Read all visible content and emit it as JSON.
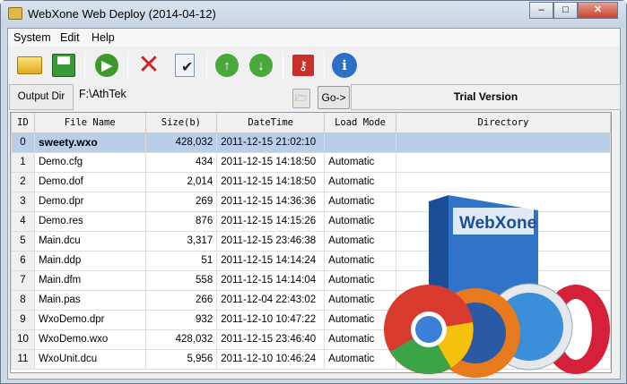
{
  "window": {
    "title": "WebXone Web Deploy (2014-04-12)"
  },
  "menu": [
    "System",
    "Edit",
    "Help"
  ],
  "toolbar": [
    "open-folder",
    "save",
    "run",
    "delete",
    "check-document",
    "move-up",
    "move-down",
    "key",
    "info"
  ],
  "output": {
    "label": "Output Dir",
    "value": "F:\\AthTek",
    "go": "Go->",
    "trial": "Trial Version"
  },
  "table": {
    "headers": [
      "ID",
      "File Name",
      "Size(b)",
      "DateTime",
      "Load Mode",
      "Directory"
    ],
    "rows": [
      [
        "0",
        "sweety.wxo",
        "428,032",
        "2011-12-15 21:02:10",
        "",
        ""
      ],
      [
        "1",
        "Demo.cfg",
        "434",
        "2011-12-15 14:18:50",
        "Automatic",
        ""
      ],
      [
        "2",
        "Demo.dof",
        "2,014",
        "2011-12-15 14:18:50",
        "Automatic",
        ""
      ],
      [
        "3",
        "Demo.dpr",
        "269",
        "2011-12-15 14:36:36",
        "Automatic",
        ""
      ],
      [
        "4",
        "Demo.res",
        "876",
        "2011-12-15 14:15:26",
        "Automatic",
        ""
      ],
      [
        "5",
        "Main.dcu",
        "3,317",
        "2011-12-15 23:46:38",
        "Automatic",
        ""
      ],
      [
        "6",
        "Main.ddp",
        "51",
        "2011-12-15 14:14:24",
        "Automatic",
        ""
      ],
      [
        "7",
        "Main.dfm",
        "558",
        "2011-12-15 14:14:04",
        "Automatic",
        ""
      ],
      [
        "8",
        "Main.pas",
        "266",
        "2011-12-04 22:43:02",
        "Automatic",
        ""
      ],
      [
        "9",
        "WxoDemo.dpr",
        "932",
        "2011-12-10 10:47:22",
        "Automatic",
        ""
      ],
      [
        "10",
        "WxoDemo.wxo",
        "428,032",
        "2011-12-15 23:46:40",
        "Automatic",
        ""
      ],
      [
        "11",
        "WxoUnit.dcu",
        "5,956",
        "2011-12-10 10:46:24",
        "Automatic",
        ""
      ]
    ]
  },
  "promo": {
    "box_text": "WebXone"
  }
}
